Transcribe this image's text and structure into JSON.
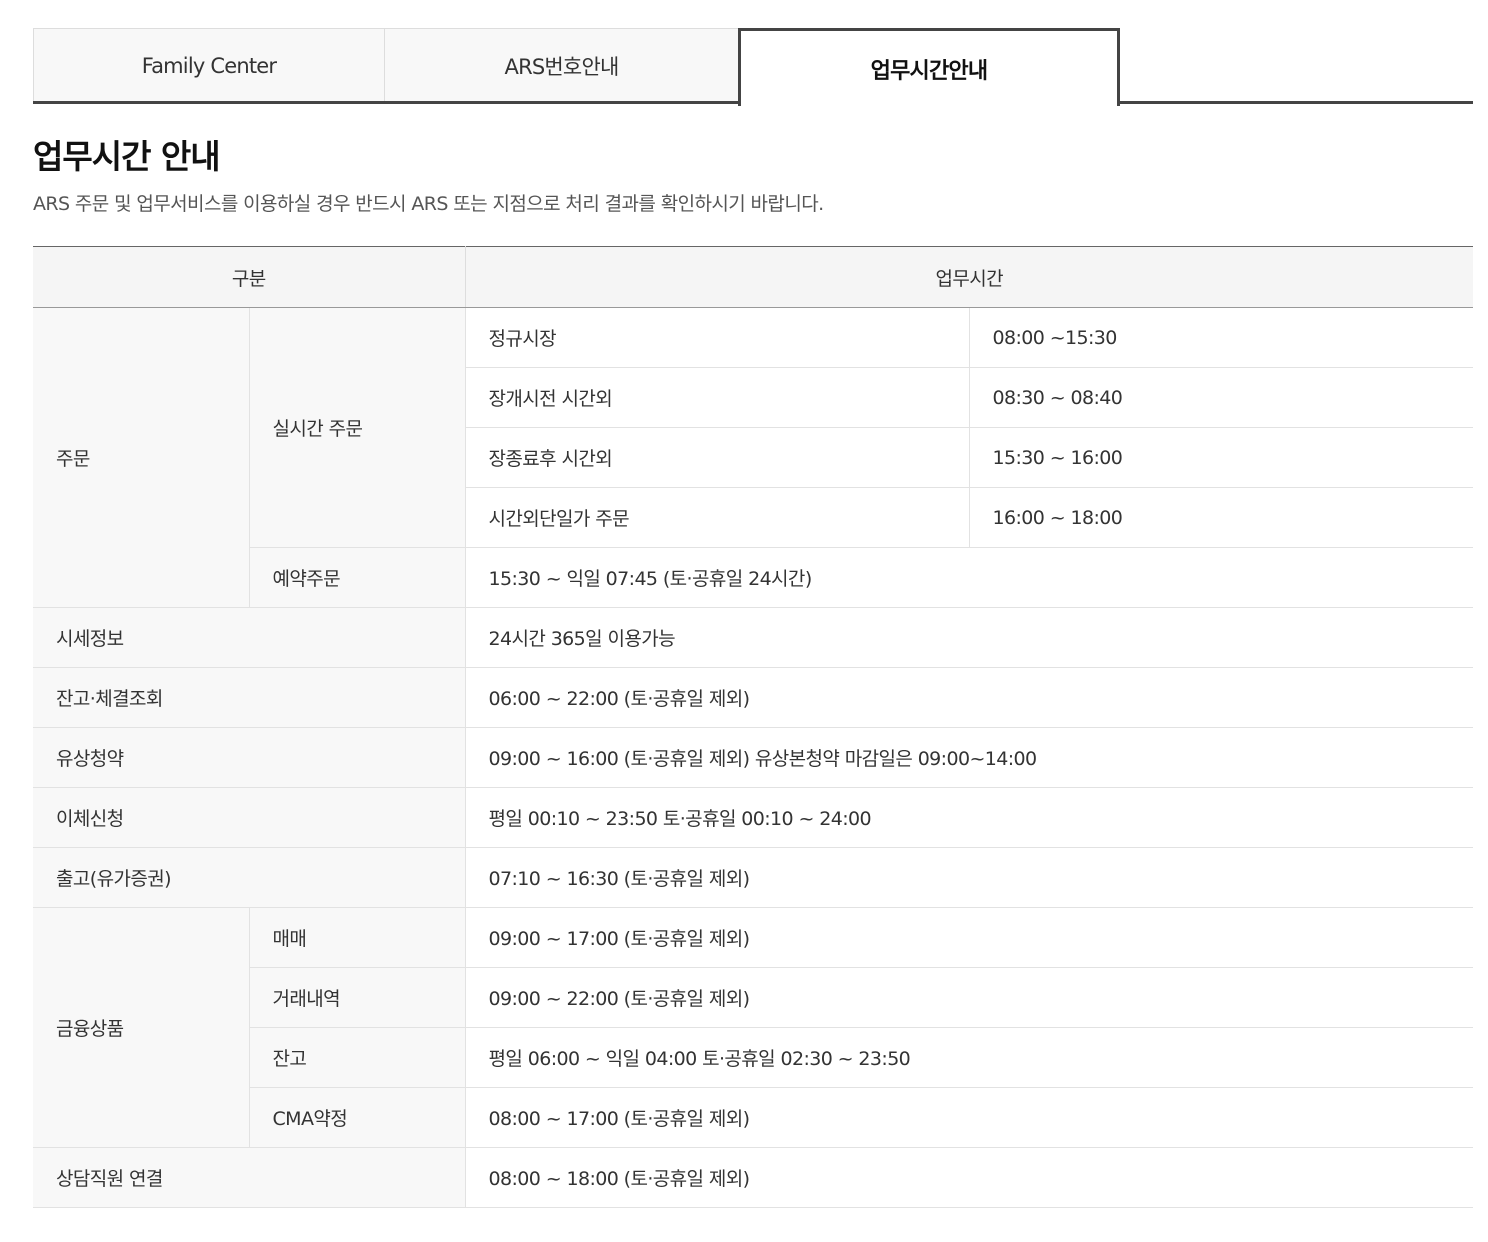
{
  "tabs": [
    {
      "label": "Family Center",
      "active": false
    },
    {
      "label": "ARS번호안내",
      "active": false
    },
    {
      "label": "업무시간안내",
      "active": true
    }
  ],
  "heading": {
    "title": "업무시간 안내",
    "description": "ARS 주문 및 업무서비스를 이용하실 경우 반드시 ARS 또는 지점으로 처리 결과를 확인하시기 바랍니다."
  },
  "table": {
    "headers": {
      "category": "구분",
      "hours": "업무시간"
    },
    "order": {
      "category": "주문",
      "realtime": {
        "label": "실시간 주문",
        "rows": [
          {
            "name": "정규시장",
            "time": "08:00 ~15:30"
          },
          {
            "name": "장개시전 시간외",
            "time": "08:30 ~ 08:40"
          },
          {
            "name": "장종료후 시간외",
            "time": "15:30 ~ 16:00"
          },
          {
            "name": "시간외단일가 주문",
            "time": "16:00 ~ 18:00"
          }
        ]
      },
      "reserved": {
        "label": "예약주문",
        "time": "15:30 ~ 익일 07:45 (토·공휴일 24시간)"
      }
    },
    "simple_rows": [
      {
        "name": "시세정보",
        "time": "24시간 365일 이용가능"
      },
      {
        "name": "잔고·체결조회",
        "time": "06:00 ~ 22:00 (토·공휴일 제외)"
      },
      {
        "name": "유상청약",
        "time": "09:00 ~ 16:00 (토·공휴일 제외) 유상본청약 마감일은 09:00~14:00"
      },
      {
        "name": "이체신청",
        "time": "평일 00:10 ~ 23:50 토·공휴일 00:10 ~ 24:00"
      },
      {
        "name": "출고(유가증권)",
        "time": "07:10 ~ 16:30 (토·공휴일 제외)"
      }
    ],
    "financial": {
      "category": "금융상품",
      "rows": [
        {
          "name": "매매",
          "time": "09:00 ~ 17:00 (토·공휴일 제외)"
        },
        {
          "name": "거래내역",
          "time": "09:00 ~ 22:00 (토·공휴일 제외)"
        },
        {
          "name": "잔고",
          "time": "평일 06:00 ~ 익일 04:00 토·공휴일 02:30 ~ 23:50"
        },
        {
          "name": "CMA약정",
          "time": "08:00 ~ 17:00 (토·공휴일 제외)"
        }
      ]
    },
    "consultant": {
      "name": "상담직원 연결",
      "time": "08:00 ~ 18:00 (토·공휴일 제외)"
    }
  }
}
